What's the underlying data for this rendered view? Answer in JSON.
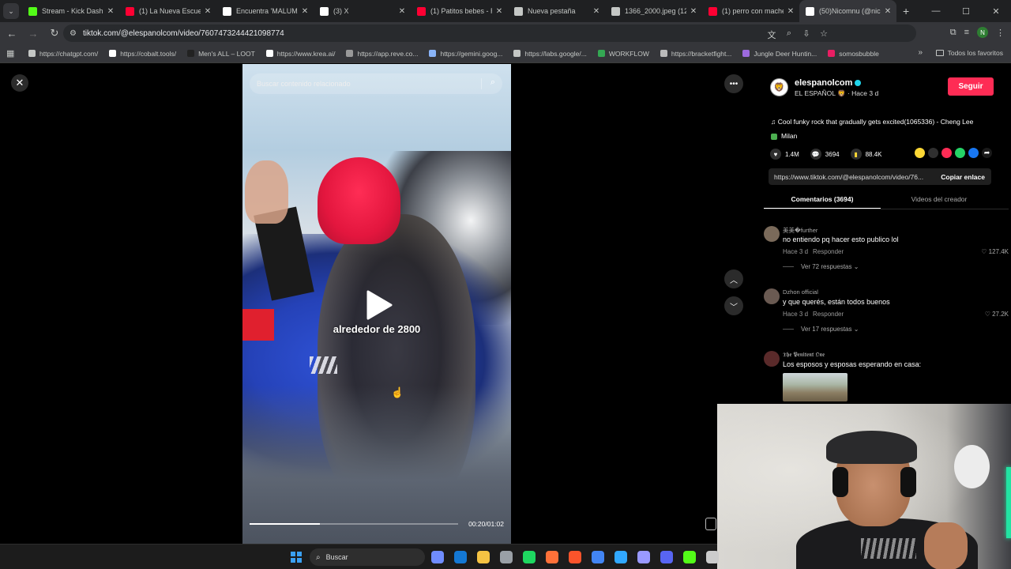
{
  "browser": {
    "tabs": [
      {
        "title": "Stream - Kick Dashbo",
        "icon": "kick-icon",
        "color": "#53fc18",
        "active": false
      },
      {
        "title": "(1) La Nueva Escuela",
        "icon": "youtube-icon",
        "color": "#ff0033",
        "active": false
      },
      {
        "title": "Encuentra 'MALUMA",
        "icon": "tiktok-icon",
        "color": "#ffffff",
        "active": false
      },
      {
        "title": "(3) X",
        "icon": "x-icon",
        "color": "#ffffff",
        "active": false
      },
      {
        "title": "(1) Patitos bebes - Re",
        "icon": "youtube-icon",
        "color": "#ff0033",
        "active": false
      },
      {
        "title": "Nueva pestaña",
        "icon": "chrome-icon",
        "color": "#c4c7c5",
        "active": false
      },
      {
        "title": "1366_2000.jpeg (128",
        "icon": "globe-icon",
        "color": "#c4c7c5",
        "active": false
      },
      {
        "title": "(1) perro con mache",
        "icon": "youtube-icon",
        "color": "#ff0033",
        "active": false
      },
      {
        "title": "(50)Nicomnu (@nico",
        "icon": "tiktok-icon",
        "color": "#ffffff",
        "active": true
      }
    ],
    "url": "tiktok.com/@elespanolcom/video/7607473244421098774",
    "profile_initial": "N",
    "bookmarks": [
      {
        "label": "https://chatgpt.com/",
        "color": "#c4c7c5"
      },
      {
        "label": "https://cobalt.tools/",
        "color": "#ffffff"
      },
      {
        "label": "Men's ALL – LOOT",
        "color": "#222222"
      },
      {
        "label": "https://www.krea.ai/",
        "color": "#ffffff"
      },
      {
        "label": "https://app.reve.co...",
        "color": "#999999"
      },
      {
        "label": "https://gemini.goog...",
        "color": "#8ab4f8"
      },
      {
        "label": "https://labs.google/...",
        "color": "#c4c7c5"
      },
      {
        "label": "WORKFLOW",
        "color": "#34a853"
      },
      {
        "label": "https://bracketfight...",
        "color": "#bbbbbb"
      },
      {
        "label": "Jungle Deer Huntin...",
        "color": "#9c6ade"
      },
      {
        "label": "somosbubble",
        "color": "#e91e63"
      }
    ],
    "all_bookmarks_label": "Todos los favoritos"
  },
  "video": {
    "search_placeholder": "Buscar contenido relacionado",
    "caption": "alrededor de 2800",
    "timecode": "00:20/01:02",
    "progress": 0.336
  },
  "panel": {
    "author": {
      "username": "elespanolcom",
      "subtitle": "EL ESPAÑOL 🦁 · Hace 3 d",
      "follow_label": "Seguir"
    },
    "music": "Cool funky rock that gradually gets excited(1065336) - Cheng Lee",
    "music_tag": "Milan",
    "stats": {
      "likes": "1.4M",
      "comments": "3694",
      "saves": "88.4K"
    },
    "share_link": "https://www.tiktok.com/@elespanolcom/video/76...",
    "copy_label": "Copiar enlace",
    "tabs": [
      {
        "label": "Comentarios (3694)",
        "active": true
      },
      {
        "label": "Videos del creador",
        "active": false
      }
    ],
    "comments": [
      {
        "name": "美美�further",
        "text": "no entiendo pq hacer esto publico lol",
        "time": "Hace 3 d",
        "reply": "Responder",
        "likes": "127.4K",
        "replies": "Ver 72 respuestas",
        "avatar_color": "#7a6a5a"
      },
      {
        "name": "Dzhon official",
        "text": "y que querés, están todos buenos",
        "time": "Hace 3 d",
        "reply": "Responder",
        "likes": "27.2K",
        "replies": "Ver 17 respuestas",
        "avatar_color": "#6a5a52"
      },
      {
        "name": "𝕿𝖍𝖊 𝕻𝖊𝖓𝖎𝖙𝖊𝖓𝖙 𝕺𝖓𝖊",
        "text": "Los esposos y esposas esperando en casa:",
        "avatar_color": "#5a2a2a"
      }
    ]
  },
  "taskbar": {
    "search_label": "Buscar",
    "apps": [
      {
        "icon": "copilot-icon",
        "color": "#6f8cff"
      },
      {
        "icon": "outlook-icon",
        "color": "#1478d4"
      },
      {
        "icon": "file-explorer-icon",
        "color": "#f6c343"
      },
      {
        "icon": "settings-icon",
        "color": "#9aa0a6"
      },
      {
        "icon": "spotify-icon",
        "color": "#1ed760"
      },
      {
        "icon": "firefox-icon",
        "color": "#ff7139"
      },
      {
        "icon": "brave-icon",
        "color": "#fb542b"
      },
      {
        "icon": "chrome-icon",
        "color": "#4285f4"
      },
      {
        "icon": "photoshop-icon",
        "color": "#31a8ff"
      },
      {
        "icon": "premiere-icon",
        "color": "#9999ff"
      },
      {
        "icon": "discord-icon",
        "color": "#5865f2"
      },
      {
        "icon": "kick-icon",
        "color": "#53fc18"
      },
      {
        "icon": "app-icon",
        "color": "#cccccc"
      }
    ]
  }
}
